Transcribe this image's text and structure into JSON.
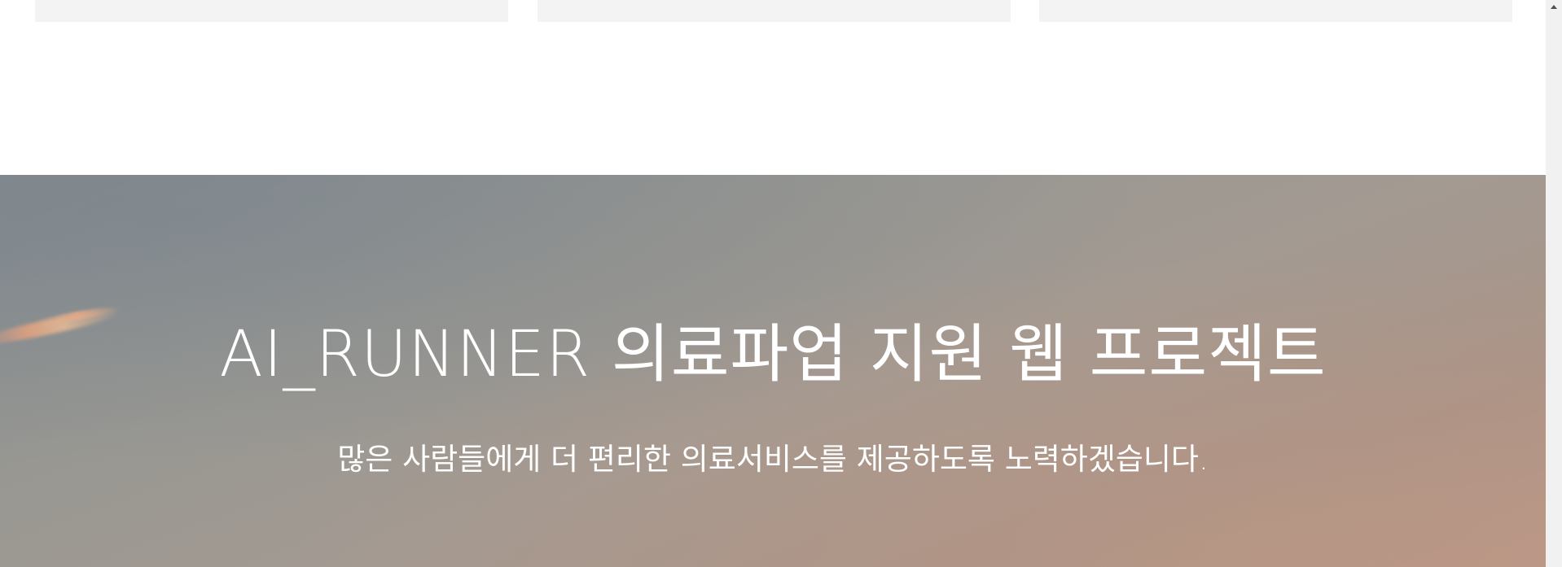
{
  "hero": {
    "title": "AI_RUNNER 의료파업 지원 웹 프로젝트",
    "subtitle": "많은 사람들에게 더 편리한 의료서비스를 제공하도록 노력하겠습니다."
  },
  "icons": {
    "scroll_up": "scroll-up-arrow-icon"
  }
}
